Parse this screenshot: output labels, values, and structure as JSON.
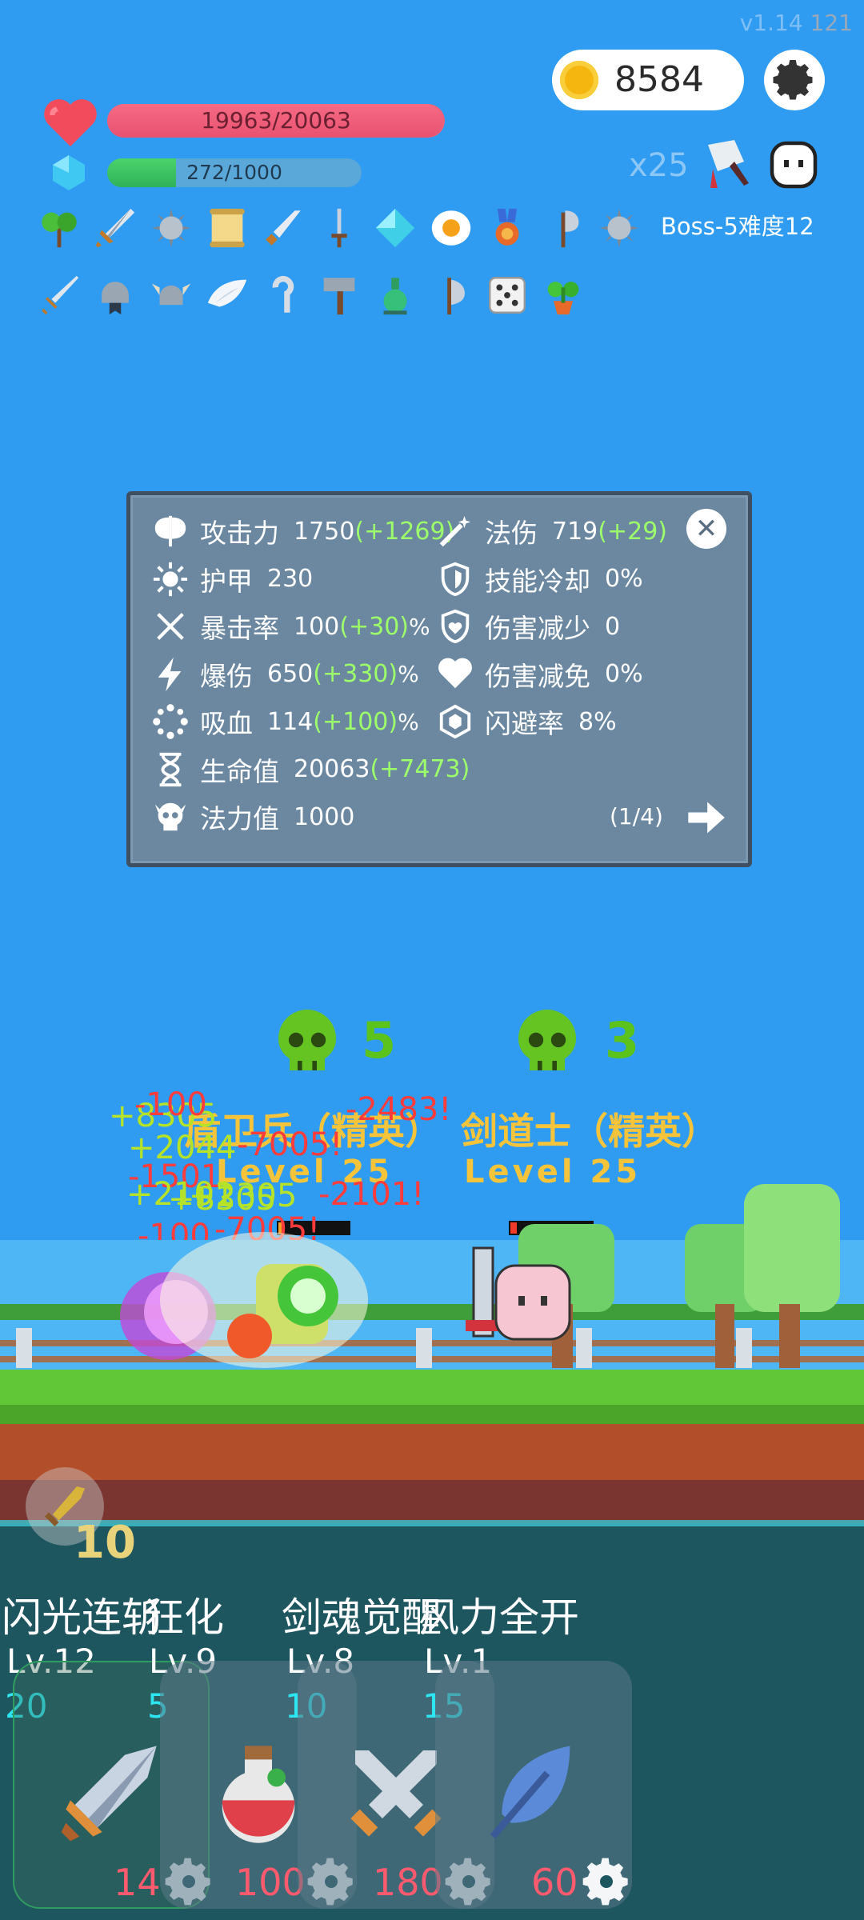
{
  "version": {
    "label": "v1.14",
    "build": "121"
  },
  "currency": {
    "coins": "8584"
  },
  "player": {
    "hp": {
      "text": "19963/20063",
      "fraction": 0.995
    },
    "mp": {
      "text": "272/1000",
      "fraction": 0.272
    }
  },
  "speed": {
    "multiplier": "x25"
  },
  "boss": {
    "label": "Boss-5难度12"
  },
  "items": {
    "row1": [
      "sapling-icon",
      "sword-icon",
      "spiked-mace-icon",
      "scroll-icon",
      "dagger-icon",
      "short-blade-icon",
      "diamond-icon",
      "fried-egg-icon",
      "medal-icon",
      "axe-icon",
      "spiked-mace-icon"
    ],
    "row2": [
      "short-sword-icon",
      "helmet-medal-icon",
      "viking-helmet-icon",
      "wing-icon",
      "hook-icon",
      "hammer-icon",
      "potion-flask-icon",
      "battle-axe-icon",
      "dice-icon",
      "potted-plant-icon"
    ]
  },
  "stats": {
    "left": [
      {
        "icon": "axe-icon",
        "name": "攻击力",
        "value": "1750",
        "bonus": "(+1269)",
        "suffix": ""
      },
      {
        "icon": "sun-icon",
        "name": "护甲",
        "value": "230",
        "bonus": "",
        "suffix": ""
      },
      {
        "icon": "crossed-swords-icon",
        "name": "暴击率",
        "value": "100",
        "bonus": "(+30)",
        "suffix": "%"
      },
      {
        "icon": "lightning-icon",
        "name": "爆伤",
        "value": "650",
        "bonus": "(+330)",
        "suffix": "%"
      },
      {
        "icon": "lifesteal-icon",
        "name": "吸血",
        "value": "114",
        "bonus": "(+100)",
        "suffix": "%"
      },
      {
        "icon": "hourglass-icon",
        "name": "生命值",
        "value": "20063",
        "bonus": "(+7473)",
        "suffix": ""
      },
      {
        "icon": "skull-icon",
        "name": "法力值",
        "value": "1000",
        "bonus": "",
        "suffix": ""
      }
    ],
    "right": [
      {
        "icon": "wand-icon",
        "name": "法伤",
        "value": "719",
        "bonus": "(+29)",
        "suffix": ""
      },
      {
        "icon": "shield-icon",
        "name": "技能冷却",
        "value": "0%",
        "bonus": "",
        "suffix": ""
      },
      {
        "icon": "heart-shield-icon",
        "name": "伤害减少",
        "value": "0",
        "bonus": "",
        "suffix": ""
      },
      {
        "icon": "heart-icon",
        "name": "伤害减免",
        "value": "0%",
        "bonus": "",
        "suffix": ""
      },
      {
        "icon": "hexagon-icon",
        "name": "闪避率",
        "value": "8%",
        "bonus": "",
        "suffix": ""
      }
    ],
    "page": "(1/4)"
  },
  "enemies": [
    {
      "skull_count": "5",
      "name": "盾卫兵（精英）",
      "level": "Level 25",
      "hp_fraction": 0.05
    },
    {
      "skull_count": "3",
      "name": "剑道士（精英）",
      "level": "Level 25",
      "hp_fraction": 0.08
    }
  ],
  "floating_text": {
    "damage": [
      "-100",
      "-7005!",
      "-2483!",
      "-1501",
      "-2101!",
      "-100",
      "-7005!"
    ],
    "heal": [
      "+8305",
      "+2044",
      "+2101",
      "+8305",
      "+2305"
    ]
  },
  "skill_points": "10",
  "skills": [
    {
      "name": "闪光连斩",
      "level": "Lv.12",
      "cost": "20",
      "cooldown": "14",
      "icon": "sword-icon"
    },
    {
      "name": "狂化",
      "level": "Lv.9",
      "cost": "5",
      "cooldown": "100",
      "icon": "potion-icon"
    },
    {
      "name": "剑魂觉醒",
      "level": "Lv.8",
      "cost": "10",
      "cooldown": "180",
      "icon": "crossed-swords-icon"
    },
    {
      "name": "风力全开",
      "level": "Lv.1",
      "cost": "15",
      "cooldown": "60",
      "icon": "feather-icon"
    }
  ],
  "colors": {
    "background": "#2f9cf2",
    "hp": "#f0607a",
    "mp_fill": "#3fc060",
    "bonus": "#9dff6a",
    "damage": "#ff3b3b",
    "enemy_label": "#f5c43a",
    "skill_cost": "#2ee6f2",
    "skill_cooldown": "#ff5a6e"
  }
}
